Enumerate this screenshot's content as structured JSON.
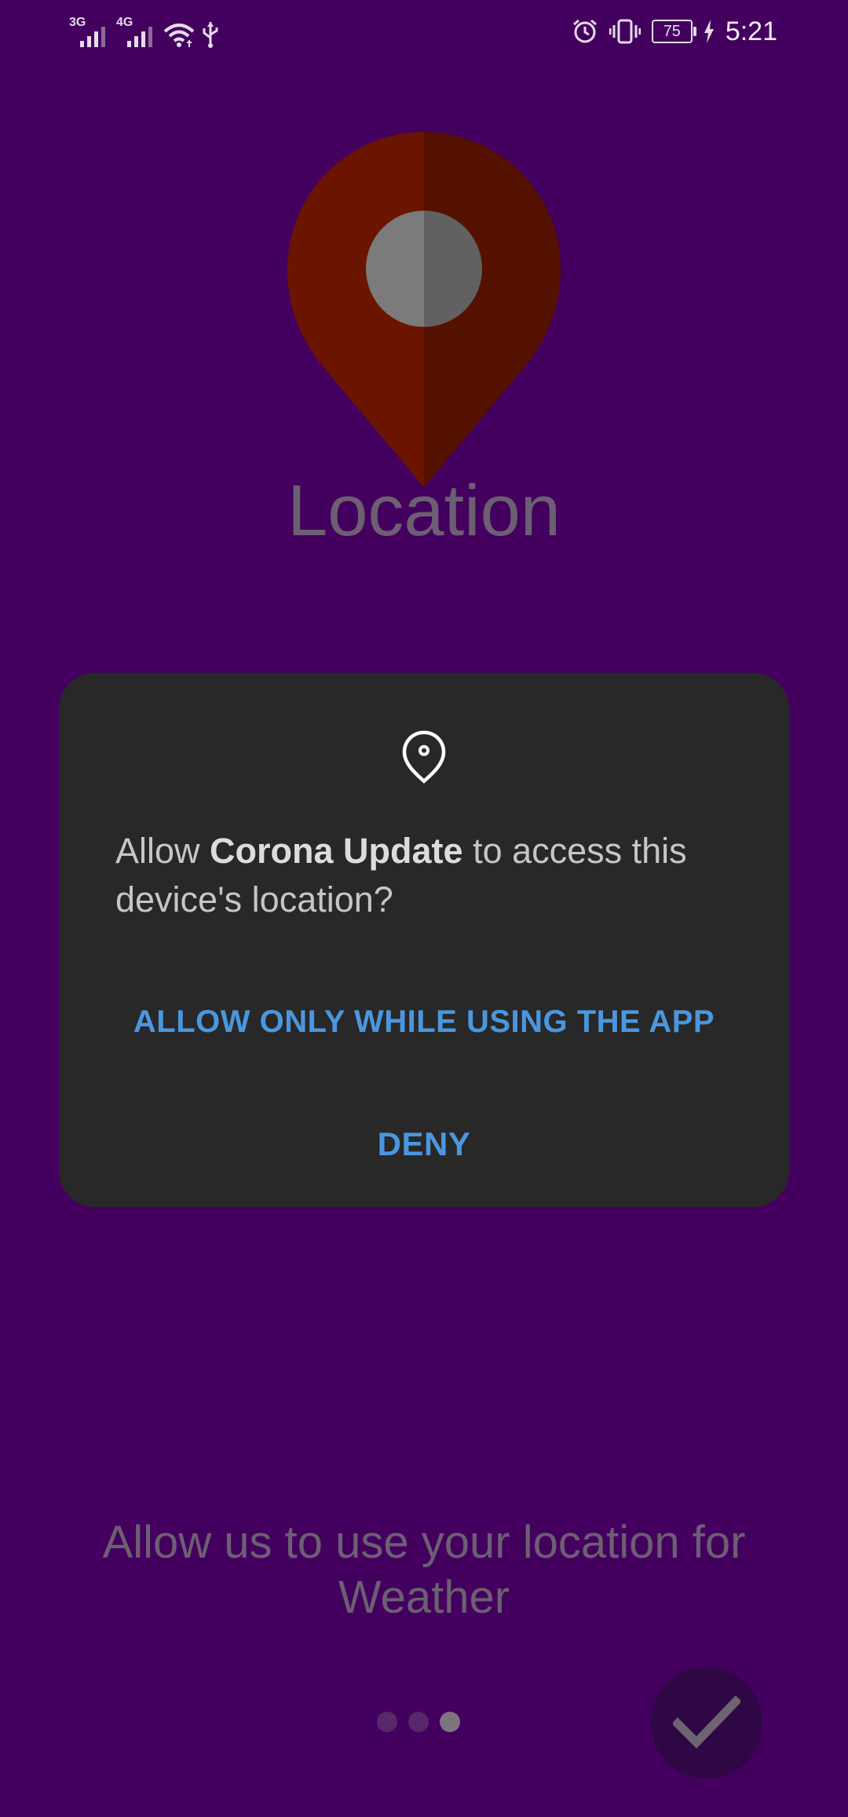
{
  "status_bar": {
    "sim1_label": "3G",
    "sim2_label": "4G",
    "battery_level": "75",
    "time": "5:21",
    "icons": [
      "signal-3g-icon",
      "signal-4g-icon",
      "wifi-icon",
      "usb-icon",
      "alarm-icon",
      "vibrate-icon",
      "battery-icon",
      "charging-icon"
    ]
  },
  "background": {
    "title": "Location",
    "subtitle": "Allow us  to use your location for Weather",
    "pin_icon": "location-pin-icon",
    "pin_color": "#6b1400",
    "pin_shadow_color": "#551100",
    "fab_icon": "checkmark-icon"
  },
  "page_indicator": {
    "total_pages": 3,
    "active_index": 3
  },
  "dialog": {
    "icon": "location-pin-outline-icon",
    "message_prefix": "Allow ",
    "app_name": "Corona Update",
    "message_suffix": " to access this device's location?",
    "allow_label": "ALLOW ONLY WHILE USING THE APP",
    "deny_label": "DENY",
    "accent_color": "#4a97e0",
    "background_color": "#282828"
  },
  "colors": {
    "screen_background": "#43005f",
    "muted_text": "#6c5f72"
  }
}
